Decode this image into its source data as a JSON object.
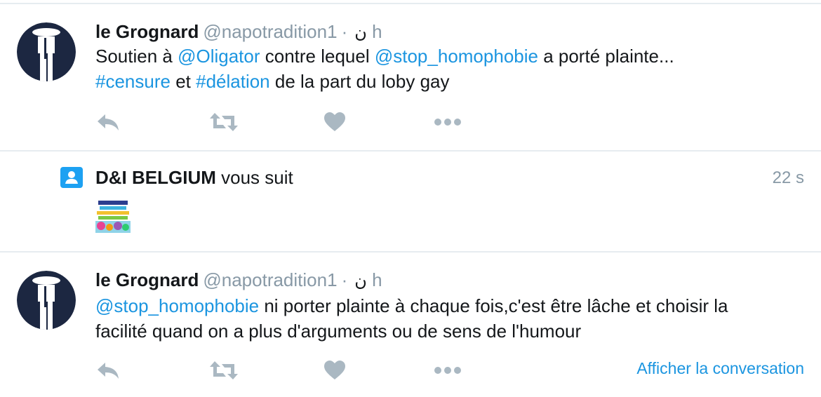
{
  "tweets": [
    {
      "name": "le Grognard",
      "handle": "@napotradition",
      "glyph": "ن",
      "sep": "·",
      "time": "1 h",
      "text": [
        {
          "t": "Soutien à ",
          "link": false
        },
        {
          "t": "@Oligator",
          "link": true
        },
        {
          "t": " contre lequel ",
          "link": false
        },
        {
          "t": "@stop_homophobie",
          "link": true
        },
        {
          "t": " a porté plainte...",
          "link": false
        }
      ],
      "text2": [
        {
          "t": "#censure",
          "link": true
        },
        {
          "t": " et ",
          "link": false
        },
        {
          "t": "#délation",
          "link": true
        },
        {
          "t": " de la part du loby gay",
          "link": false
        }
      ]
    },
    {
      "name": "le Grognard",
      "handle": "@napotradition",
      "glyph": "ن",
      "sep": "·",
      "time": "1 h",
      "text": [
        {
          "t": "@stop_homophobie",
          "link": true
        },
        {
          "t": " ni porter plainte à chaque fois,c'est être lâche et choisir la",
          "link": false
        }
      ],
      "text2": [
        {
          "t": "facilité quand on a plus d'arguments ou de sens de l'humour",
          "link": false
        }
      ],
      "conversation_link": "Afficher la conversation"
    }
  ],
  "follow": {
    "name": "D&I BELGIUM",
    "verb": " vous suit",
    "time": "22 s"
  },
  "icons": {
    "reply": "reply-icon",
    "retweet": "retweet-icon",
    "like": "heart-icon",
    "more": "more-icon",
    "follow": "person-icon"
  },
  "colors": {
    "link": "#1b95e0",
    "muted": "#8899a6",
    "icon": "#aab8c2",
    "follow_icon": "#1da1f2",
    "avatar": "#1c2741"
  }
}
